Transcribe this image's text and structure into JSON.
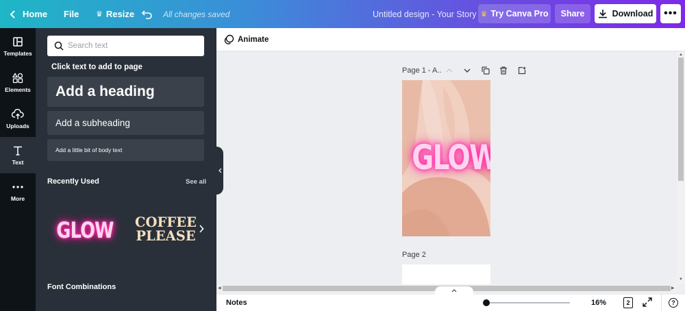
{
  "topbar": {
    "home": "Home",
    "file": "File",
    "resize": "Resize",
    "saved_status": "All changes saved",
    "doc_title": "Untitled design - Your Story",
    "try_pro": "Try Canva Pro",
    "share": "Share",
    "download": "Download",
    "more": "•••"
  },
  "rail": {
    "items": [
      {
        "label": "Templates",
        "icon": "templates-icon"
      },
      {
        "label": "Elements",
        "icon": "elements-icon"
      },
      {
        "label": "Uploads",
        "icon": "uploads-icon"
      },
      {
        "label": "Text",
        "icon": "text-icon"
      },
      {
        "label": "More",
        "icon": "more-icon"
      }
    ]
  },
  "panel": {
    "search_placeholder": "Search text",
    "click_text": "Click text to add to page",
    "add_heading": "Add a heading",
    "add_subheading": "Add a subheading",
    "add_body": "Add a little bit of body text",
    "recently_used": "Recently Used",
    "see_all": "See all",
    "recent_items": [
      "GLOW",
      "COFFEE PLEASE"
    ],
    "coffee_line1": "COFFEE",
    "coffee_line2": "PLEASE",
    "font_combinations": "Font Combinations"
  },
  "canvas": {
    "animate": "Animate",
    "page1_label": "Page 1 - A..",
    "page1_text": "GLOW",
    "page2_label": "Page 2"
  },
  "footer": {
    "notes": "Notes",
    "zoom": "16%",
    "page_count": "2",
    "help": "?"
  },
  "colors": {
    "accent_purple": "#7d2ae8",
    "teal": "#1fb6c6",
    "panel_bg": "#293039",
    "rail_bg": "#0e1318",
    "neon_pink": "#ff1fa6"
  }
}
